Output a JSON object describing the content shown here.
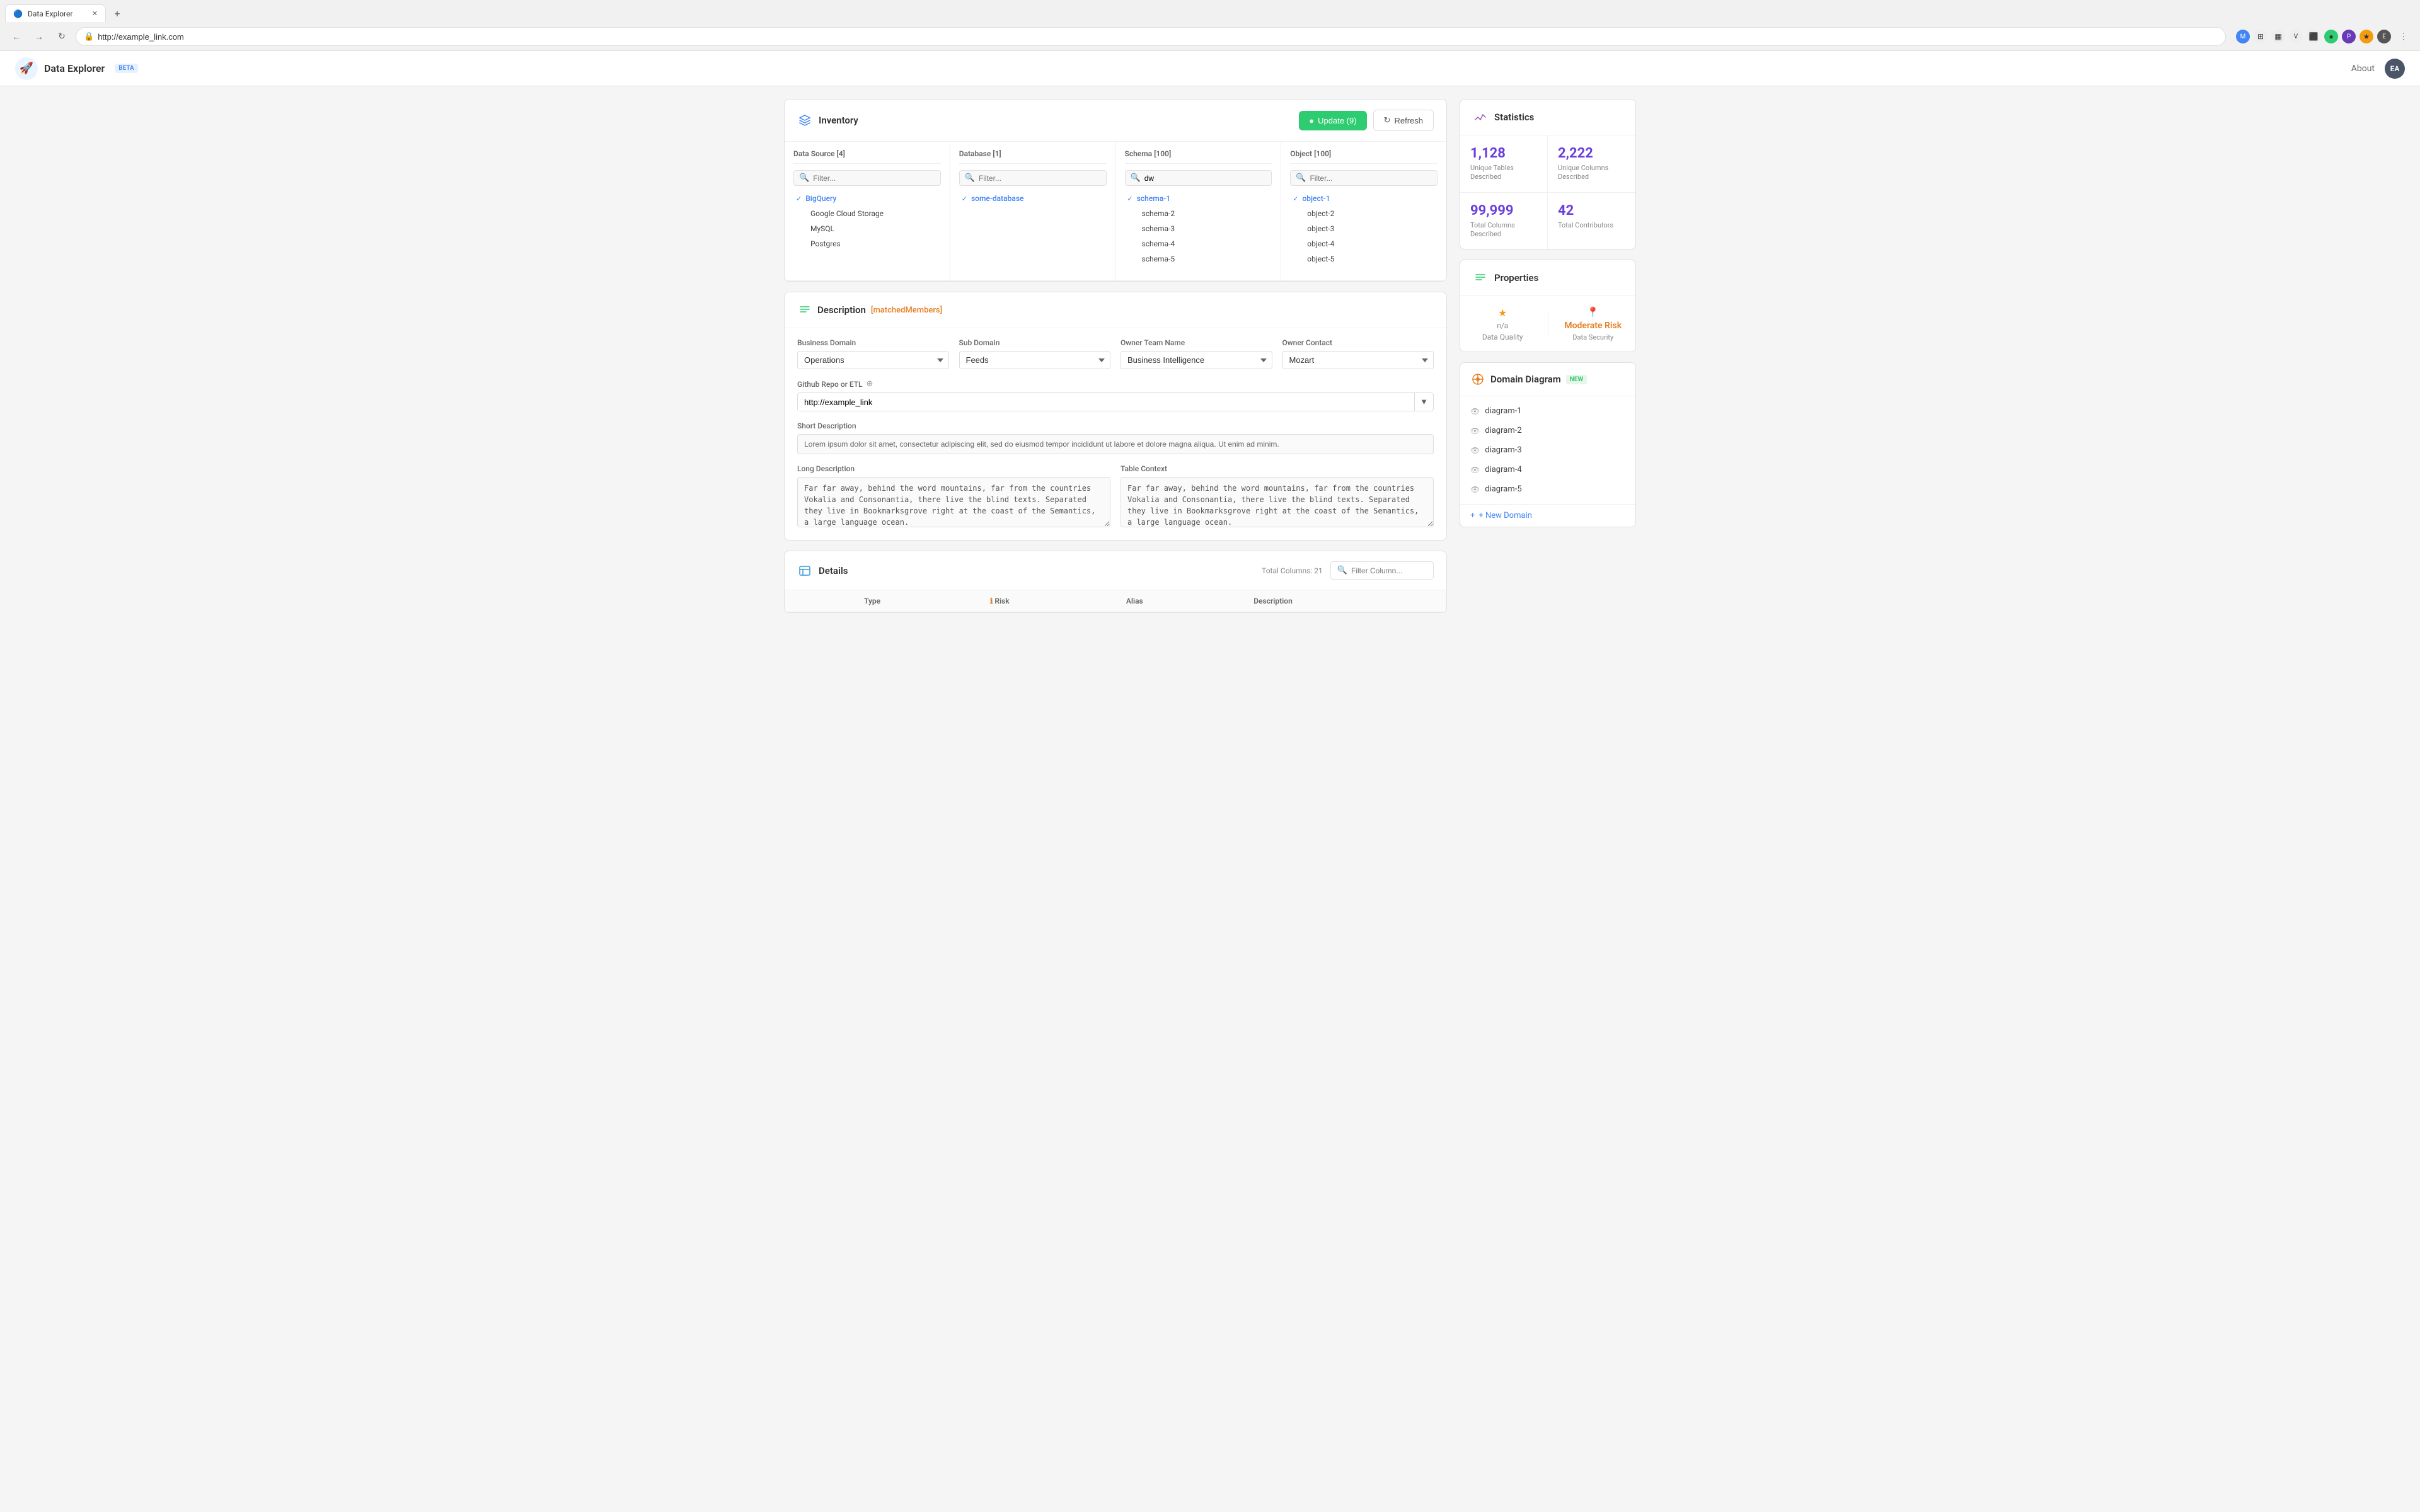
{
  "browser": {
    "tab_title": "Data Explorer",
    "url": "http://example_link.com",
    "new_tab_label": "+"
  },
  "header": {
    "logo_emoji": "🚀",
    "app_title": "Data Explorer",
    "beta_label": "BETA",
    "about_label": "About",
    "user_initials": "EA"
  },
  "inventory": {
    "title": "Inventory",
    "update_btn": "Update (9)",
    "refresh_btn": "Refresh",
    "datasource_header": "Data Source [4]",
    "database_header": "Database [1]",
    "schema_header": "Schema [100]",
    "object_header": "Object [100]",
    "datasource_filter_placeholder": "Filter...",
    "database_filter_placeholder": "Filter...",
    "object_filter_placeholder": "Filter...",
    "schema_filter_value": "dw",
    "datasources": [
      {
        "name": "BigQuery",
        "selected": true
      },
      {
        "name": "Google Cloud Storage",
        "selected": false
      },
      {
        "name": "MySQL",
        "selected": false
      },
      {
        "name": "Postgres",
        "selected": false
      }
    ],
    "databases": [
      {
        "name": "some-database",
        "selected": true
      }
    ],
    "schemas": [
      {
        "name": "schema-1",
        "selected": true
      },
      {
        "name": "schema-2",
        "selected": false
      },
      {
        "name": "schema-3",
        "selected": false
      },
      {
        "name": "schema-4",
        "selected": false
      },
      {
        "name": "schema-5",
        "selected": false
      }
    ],
    "objects": [
      {
        "name": "object-1",
        "selected": true
      },
      {
        "name": "object-2",
        "selected": false
      },
      {
        "name": "object-3",
        "selected": false
      },
      {
        "name": "object-4",
        "selected": false
      },
      {
        "name": "object-5",
        "selected": false
      }
    ]
  },
  "description": {
    "title": "Description",
    "matched_label": "[matchedMembers]",
    "business_domain_label": "Business Domain",
    "business_domain_value": "Operations",
    "sub_domain_label": "Sub Domain",
    "sub_domain_value": "Feeds",
    "owner_team_label": "Owner Team Name",
    "owner_team_value": "Business Intelligence",
    "owner_contact_label": "Owner Contact",
    "owner_contact_value": "Mozart",
    "github_label": "Github Repo or ETL",
    "github_value": "http://example_link",
    "short_desc_label": "Short Description",
    "short_desc_value": "Lorem ipsum dolor sit amet, consectetur adipiscing elit, sed do eiusmod tempor incididunt ut labore et dolore magna aliqua. Ut enim ad minim.",
    "long_desc_label": "Long Description",
    "long_desc_value": "Far far away, behind the word mountains, far from the countries Vokalia and Consonantia, there live the blind texts. Separated they live in Bookmarksgrove right at the coast of the Semantics, a large language ocean.",
    "table_context_label": "Table Context",
    "table_context_value": "Far far away, behind the word mountains, far from the countries Vokalia and Consonantia, there live the blind texts. Separated they live in Bookmarksgrove right at the coast of the Semantics, a large language ocean."
  },
  "statistics": {
    "title": "Statistics",
    "unique_tables_value": "1,128",
    "unique_tables_label": "Unique Tables Described",
    "unique_columns_value": "2,222",
    "unique_columns_label": "Unique Columns Described",
    "total_columns_value": "99,999",
    "total_columns_label": "Total Columns Described",
    "total_contributors_value": "42",
    "total_contributors_label": "Total Contributors"
  },
  "properties": {
    "title": "Properties",
    "data_quality_label": "Data Quality",
    "data_quality_value": "n/a",
    "risk_label": "Moderate Risk",
    "risk_sublabel": "Data Security"
  },
  "domain_diagram": {
    "title": "Domain Diagram",
    "new_label": "NEW",
    "items": [
      "diagram-1",
      "diagram-2",
      "diagram-3",
      "diagram-4",
      "diagram-5"
    ],
    "new_domain_btn": "+ New Domain"
  },
  "details": {
    "title": "Details",
    "total_columns_label": "Total Columns: 21",
    "filter_placeholder": "Filter Column...",
    "columns": [
      {
        "label": ""
      },
      {
        "label": "Type"
      },
      {
        "label": "Risk"
      },
      {
        "label": "Alias"
      },
      {
        "label": "Description"
      }
    ]
  }
}
